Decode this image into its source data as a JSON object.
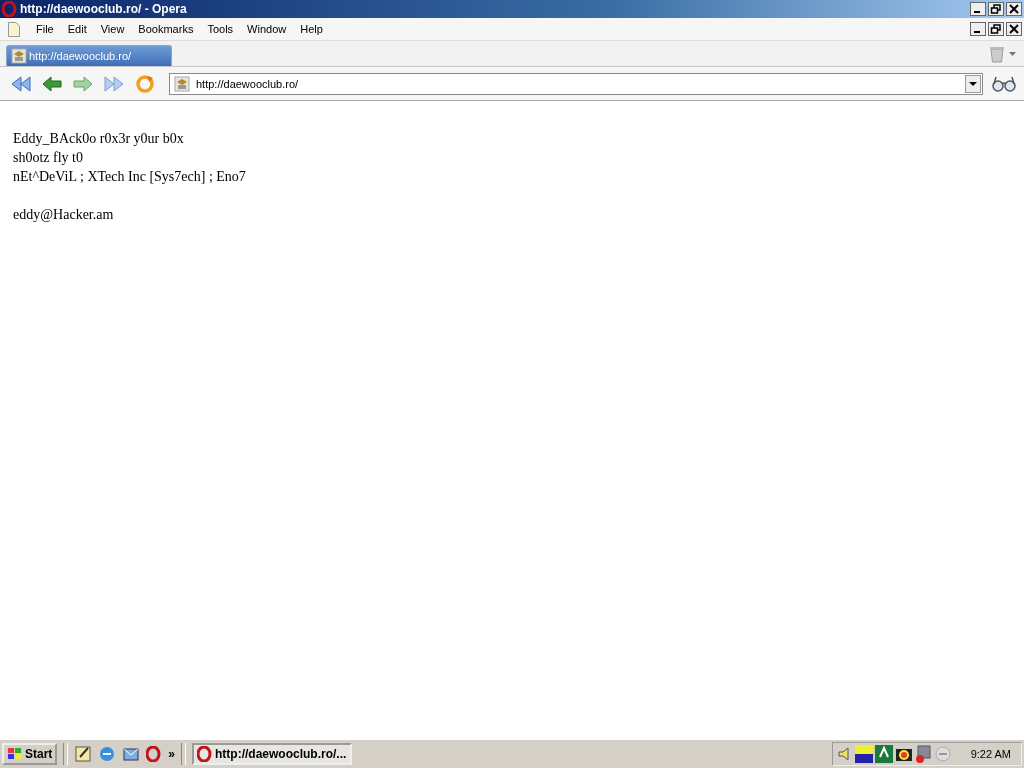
{
  "window": {
    "title": "http://daewooclub.ro/ - Opera"
  },
  "menu": [
    {
      "label": "File"
    },
    {
      "label": "Edit"
    },
    {
      "label": "View"
    },
    {
      "label": "Bookmarks"
    },
    {
      "label": "Tools"
    },
    {
      "label": "Window"
    },
    {
      "label": "Help"
    }
  ],
  "tabs": [
    {
      "label": "http://daewooclub.ro/",
      "selected": true
    }
  ],
  "address_bar": {
    "value": "http://daewooclub.ro/"
  },
  "page": {
    "paragraphs": [
      {
        "lines": [
          "Eddy_BAck0o r0x3r y0ur b0x",
          "sh0otz fly t0",
          "nEt^DeViL ; XTech Inc [Sys7ech] ; Eno7"
        ]
      },
      {
        "lines": [
          "eddy@Hacker.am"
        ]
      }
    ]
  },
  "taskbar": {
    "start": "Start",
    "more": "»",
    "tasks": [
      {
        "label": "http://daewooclub.ro/...",
        "selected": true
      }
    ],
    "clock": "9:22 AM"
  }
}
